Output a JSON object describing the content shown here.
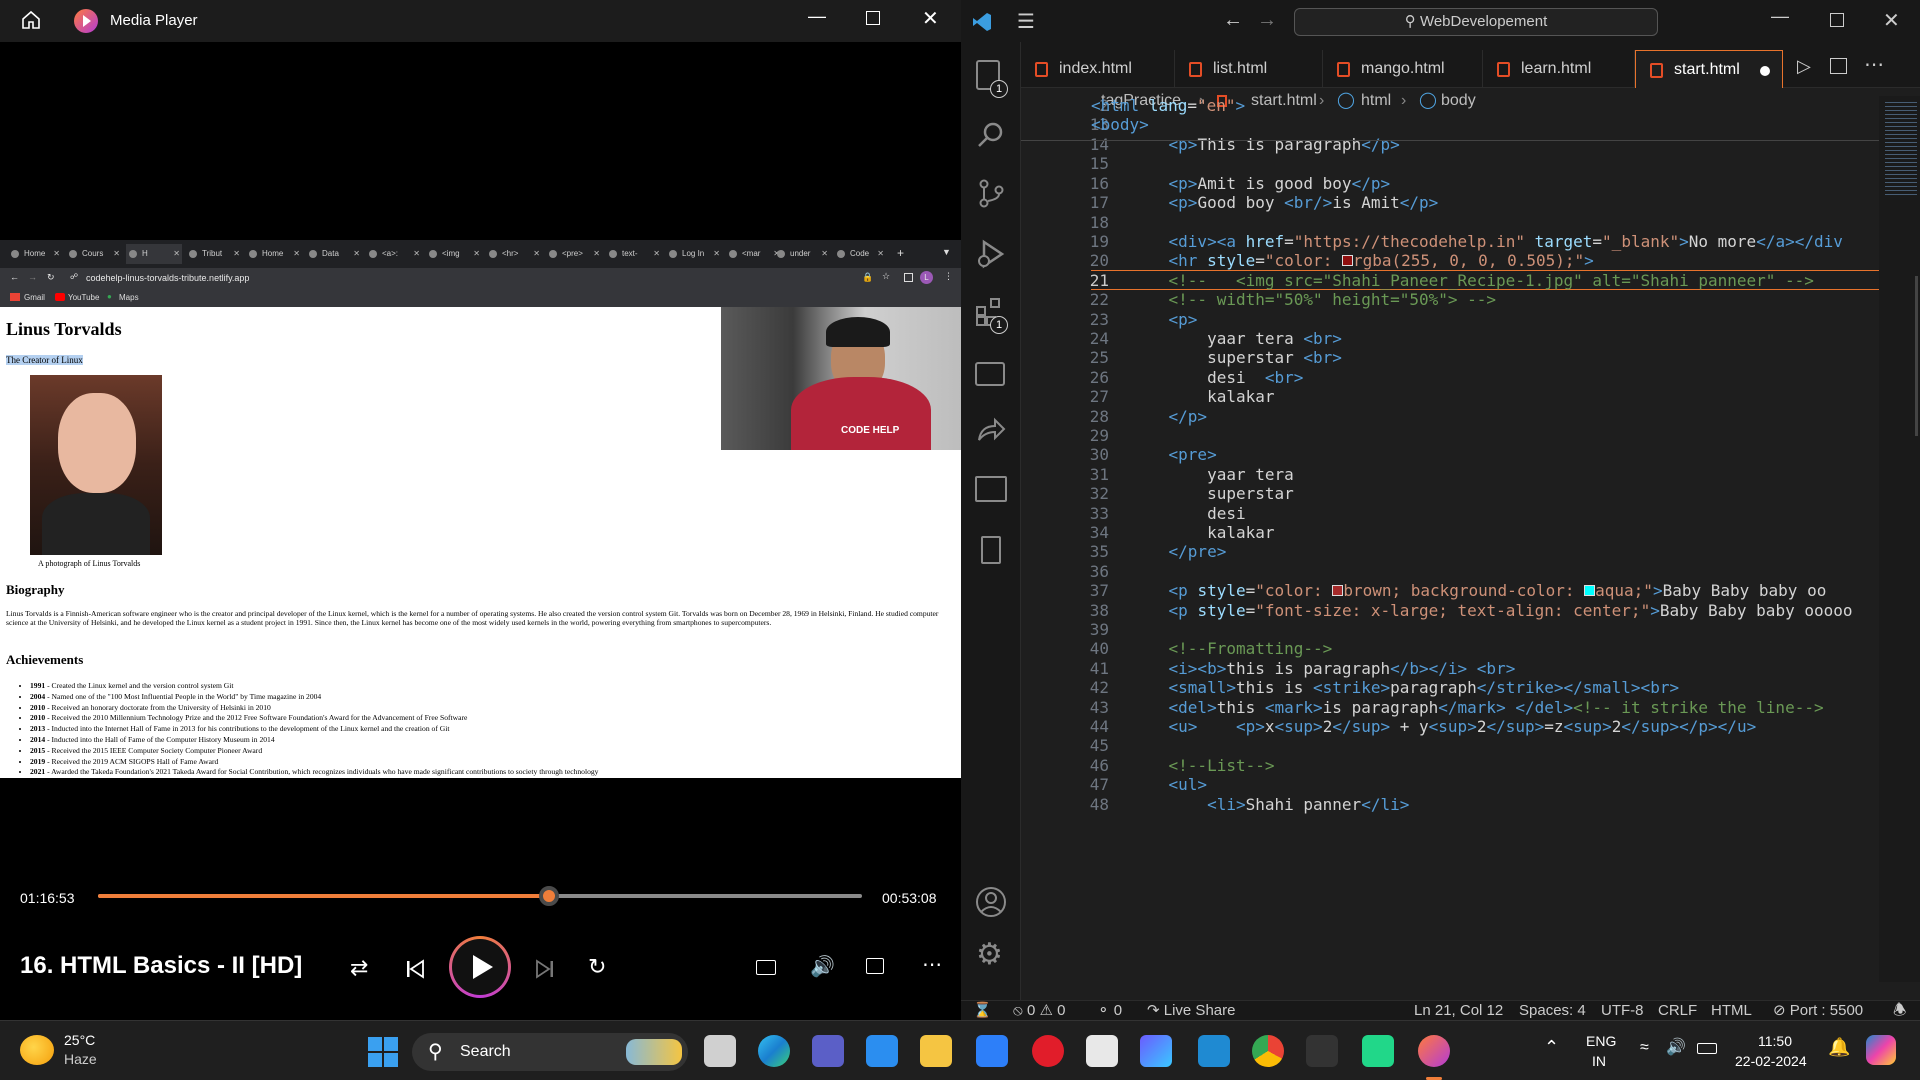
{
  "media_player": {
    "title": "Media Player",
    "elapsed": "01:16:53",
    "remaining": "00:53:08",
    "progress": 0.59,
    "video_title": "16. HTML Basics - II [HD]"
  },
  "browser": {
    "tabs": [
      "Home",
      "Cours",
      "H",
      "Tribut",
      "Home",
      "Data",
      "<a>:",
      "<img",
      "<hr>",
      "<pre>",
      "text-",
      "Log In",
      "<mar",
      "under",
      "Code"
    ],
    "url": "codehelp-linus-torvalds-tribute.netlify.app",
    "bookmarks": [
      "Gmail",
      "YouTube",
      "Maps"
    ],
    "webcam_label": "CODE HELP"
  },
  "tribute": {
    "h1": "Linus Torvalds",
    "subtitle": "The Creator of Linux",
    "caption": "A photograph of Linus Torvalds",
    "bio_heading": "Biography",
    "bio": "Linus Torvalds is a Finnish-American software engineer who is the creator and principal developer of the Linux kernel, which is the kernel for a number of operating systems. He also created the version control system Git. Torvalds was born on December 28, 1969 in Helsinki, Finland. He studied computer science at the University of Helsinki, and he developed the Linux kernel as a student project in 1991. Since then, the Linux kernel has become one of the most widely used kernels in the world, powering everything from smartphones to supercomputers.",
    "ach_heading": "Achievements",
    "achievements": [
      {
        "year": "1991",
        "text": " - Created the Linux kernel and the version control system Git"
      },
      {
        "year": "2004",
        "text": " - Named one of the \"100 Most Influential People in the World\" by Time magazine in 2004"
      },
      {
        "year": "2010",
        "text": " - Received an honorary doctorate from the University of Helsinki in 2010"
      },
      {
        "year": "2010",
        "text": " - Received the 2010 Millennium Technology Prize and the 2012 Free Software Foundation's Award for the Advancement of Free Software"
      },
      {
        "year": "2013",
        "text": " - Inducted into the Internet Hall of Fame in 2013 for his contributions to the development of the Linux kernel and the creation of Git"
      },
      {
        "year": "2014",
        "text": " - Inducted into the Hall of Fame of the Computer History Museum in 2014"
      },
      {
        "year": "2015",
        "text": " - Received the 2015 IEEE Computer Society Computer Pioneer Award"
      },
      {
        "year": "2019",
        "text": " - Received the 2019 ACM SIGOPS Hall of Fame Award"
      },
      {
        "year": "2021",
        "text": " - Awarded the Takeda Foundation's 2021 Takeda Award for Social Contribution, which recognizes individuals who have made significant contributions to society through technology"
      }
    ]
  },
  "vscode": {
    "search": "WebDevelopement",
    "tabs": [
      "index.html",
      "list.html",
      "mango.html",
      "learn.html",
      "start.html"
    ],
    "active_tab": "start.html",
    "breadcrumbs": [
      "tagPractice",
      "start.html",
      "html",
      "body"
    ],
    "explorer_badge": "1",
    "ext_badge": "1",
    "sticky_lines": [
      {
        "n": "2",
        "html": "<span class='tag'>&lt;html</span> <span class='attr'>lang</span><span class='txt'>=</span><span class='str'>\"en\"</span><span class='tag'>&gt;</span>"
      },
      {
        "n": "13",
        "html": "<span class='tag'>&lt;body&gt;</span>"
      }
    ],
    "lines": [
      {
        "n": "14",
        "html": "    <span class='tag'>&lt;p&gt;</span>This is paragraph<span class='tag'>&lt;/p&gt;</span>"
      },
      {
        "n": "15",
        "html": ""
      },
      {
        "n": "16",
        "html": "    <span class='tag'>&lt;p&gt;</span>Amit is good boy<span class='tag'>&lt;/p&gt;</span>"
      },
      {
        "n": "17",
        "html": "    <span class='tag'>&lt;p&gt;</span>Good boy <span class='tag'>&lt;br/&gt;</span>is Amit<span class='tag'>&lt;/p&gt;</span>"
      },
      {
        "n": "18",
        "html": ""
      },
      {
        "n": "19",
        "html": "    <span class='tag'>&lt;div&gt;&lt;a</span> <span class='attr'>href</span>=<span class='str'>\"https://thecodehelp.in\"</span> <span class='attr'>target</span>=<span class='str'>\"_blank\"</span><span class='tag'>&gt;</span>No more<span class='tag'>&lt;/a&gt;&lt;/div</span>"
      },
      {
        "n": "20",
        "html": "    <span class='tag'>&lt;hr</span> <span class='attr'>style</span>=<span class='str'>\"color: <span style='display:inline-block;width:11px;height:11px;background:rgba(255,0,0,0.505);border:1px solid #ddd'></span>rgba(255, 0, 0, 0.505);\"</span><span class='tag'>&gt;</span>"
      },
      {
        "n": "21",
        "html": "    <span class='cmt'>&lt;!--   &lt;img src=\"Shahi_Paneer_Recipe-1.jpg\" alt=\"Shahi panneer\" --&gt;</span>"
      },
      {
        "n": "22",
        "html": "    <span class='cmt'>&lt;!-- width=\"50%\" height=\"50%\"&gt; --&gt;</span>"
      },
      {
        "n": "23",
        "html": "    <span class='tag'>&lt;p&gt;</span>"
      },
      {
        "n": "24",
        "html": "        yaar tera <span class='tag'>&lt;br&gt;</span>"
      },
      {
        "n": "25",
        "html": "        superstar <span class='tag'>&lt;br&gt;</span>"
      },
      {
        "n": "26",
        "html": "        desi  <span class='tag'>&lt;br&gt;</span>"
      },
      {
        "n": "27",
        "html": "        kalakar"
      },
      {
        "n": "28",
        "html": "    <span class='tag'>&lt;/p&gt;</span>"
      },
      {
        "n": "29",
        "html": ""
      },
      {
        "n": "30",
        "html": "    <span class='tag'>&lt;pre&gt;</span>"
      },
      {
        "n": "31",
        "html": "        yaar tera"
      },
      {
        "n": "32",
        "html": "        superstar"
      },
      {
        "n": "33",
        "html": "        desi"
      },
      {
        "n": "34",
        "html": "        kalakar"
      },
      {
        "n": "35",
        "html": "    <span class='tag'>&lt;/pre&gt;</span>"
      },
      {
        "n": "36",
        "html": ""
      },
      {
        "n": "37",
        "html": "    <span class='tag'>&lt;p</span> <span class='attr'>style</span>=<span class='str'>\"color: <span style='display:inline-block;width:11px;height:11px;background:brown;border:1px solid #ddd'></span>brown; background-color: <span style='display:inline-block;width:11px;height:11px;background:aqua;border:1px solid #ddd'></span>aqua;\"</span><span class='tag'>&gt;</span>Baby Baby baby oo"
      },
      {
        "n": "38",
        "html": "    <span class='tag'>&lt;p</span> <span class='attr'>style</span>=<span class='str'>\"font-size: x-large; text-align: center;\"</span><span class='tag'>&gt;</span>Baby Baby baby ooooo"
      },
      {
        "n": "39",
        "html": ""
      },
      {
        "n": "40",
        "html": "    <span class='cmt'>&lt;!--Fromatting--&gt;</span>"
      },
      {
        "n": "41",
        "html": "    <span class='tag'>&lt;i&gt;&lt;b&gt;</span>this is paragraph<span class='tag'>&lt;/b&gt;&lt;/i&gt;</span> <span class='tag'>&lt;br&gt;</span>"
      },
      {
        "n": "42",
        "html": "    <span class='tag'>&lt;small&gt;</span>this is <span class='tag'>&lt;strike&gt;</span>paragraph<span class='tag'>&lt;/strike&gt;&lt;/small&gt;&lt;br&gt;</span>"
      },
      {
        "n": "43",
        "html": "    <span class='tag'>&lt;del&gt;</span>this <span class='tag'>&lt;mark&gt;</span>is paragraph<span class='tag'>&lt;/mark&gt;</span> <span class='tag'>&lt;/del&gt;</span><span class='cmt'>&lt;!-- it strike the line--&gt;</span>"
      },
      {
        "n": "44",
        "html": "    <span class='tag'>&lt;u&gt;</span>    <span class='tag'>&lt;p&gt;</span>x<span class='tag'>&lt;sup&gt;</span>2<span class='tag'>&lt;/sup&gt;</span> + y<span class='tag'>&lt;sup&gt;</span>2<span class='tag'>&lt;/sup&gt;</span>=z<span class='tag'>&lt;sup&gt;</span>2<span class='tag'>&lt;/sup&gt;&lt;/p&gt;&lt;/u&gt;</span>"
      },
      {
        "n": "45",
        "html": ""
      },
      {
        "n": "46",
        "html": "    <span class='cmt'>&lt;!--List--&gt;</span>"
      },
      {
        "n": "47",
        "html": "    <span class='tag'>&lt;ul&gt;</span>"
      },
      {
        "n": "48",
        "html": "        <span class='tag'>&lt;li&gt;</span>Shahi panner<span class='tag'>&lt;/li&gt;</span>"
      }
    ],
    "status": {
      "errors": "0",
      "warnings": "0",
      "ports": "0",
      "live_share": "Live Share",
      "position": "Ln 21, Col 12",
      "spaces": "Spaces: 4",
      "encoding": "UTF-8",
      "eol": "CRLF",
      "language": "HTML",
      "port": "Port : 5500"
    }
  },
  "taskbar": {
    "temp": "25°C",
    "weather": "Haze",
    "search": "Search",
    "lang1": "ENG",
    "lang2": "IN",
    "time": "11:50",
    "date": "22-02-2024"
  }
}
